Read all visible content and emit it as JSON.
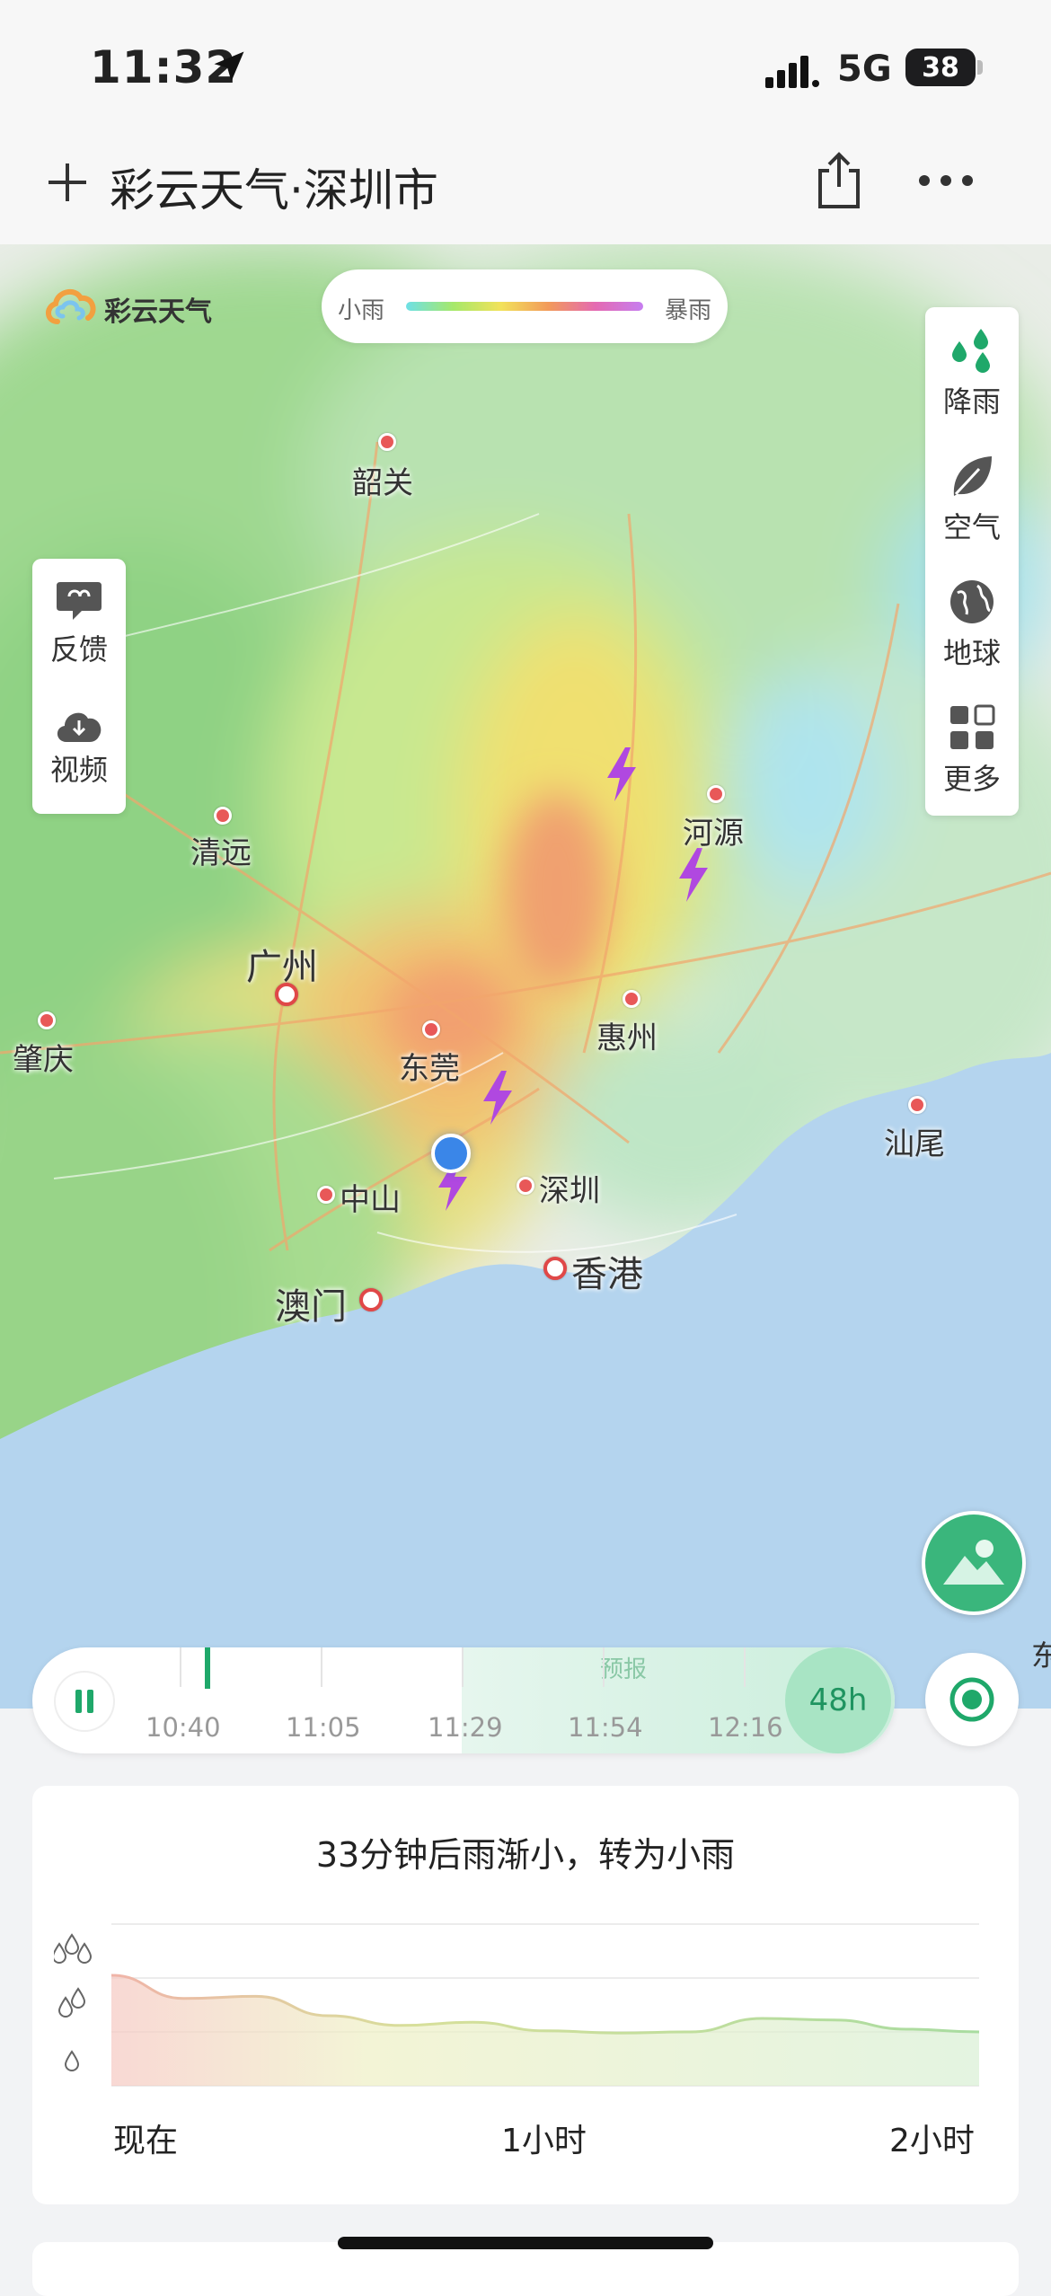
{
  "status_bar": {
    "time": "11:32",
    "network": "5G",
    "battery": "38"
  },
  "nav": {
    "title": "彩云天气·深圳市"
  },
  "map": {
    "brand_name": "彩云天气",
    "legend": {
      "min_label": "小雨",
      "max_label": "暴雨"
    },
    "cities": {
      "shaoguan": "韶关",
      "qingyuan": "清远",
      "guangzhou": "广州",
      "zhaoqing": "肇庆",
      "dongguan": "东莞",
      "huizhou": "惠州",
      "heyuan": "河源",
      "shanwei": "汕尾",
      "zhongshan": "中山",
      "shenzhen": "深圳",
      "hongkong": "香港",
      "macau": "澳门"
    },
    "edge_label": "东"
  },
  "left_panel": {
    "feedback": "反馈",
    "video": "视频"
  },
  "right_panel": {
    "rain": "降雨",
    "air": "空气",
    "globe": "地球",
    "more": "更多"
  },
  "timeline": {
    "forecast_label": "预报",
    "times": [
      "10:40",
      "11:05",
      "11:29",
      "11:54",
      "12:16"
    ],
    "range": "48h"
  },
  "precip_card": {
    "summary": "33分钟后雨渐小，转为小雨",
    "x_labels": [
      "现在",
      "1小时",
      "2小时"
    ]
  },
  "colors": {
    "accent": "#1fa86a",
    "city_dot": "#e04848",
    "chart_line": "#8fcf8f"
  },
  "chart_data": {
    "type": "area",
    "x": [
      0,
      10,
      20,
      30,
      40,
      50,
      60,
      70,
      80,
      90,
      100,
      110,
      120
    ],
    "x_tick_labels": [
      "现在",
      "1小时",
      "2小时"
    ],
    "values": [
      2.05,
      1.62,
      1.66,
      1.3,
      1.12,
      1.18,
      1.02,
      0.98,
      1.0,
      1.25,
      1.22,
      1.05,
      1.0
    ],
    "ylim": [
      0,
      3
    ],
    "y_levels": [
      "小雨",
      "中雨",
      "大雨"
    ],
    "grid": true
  }
}
